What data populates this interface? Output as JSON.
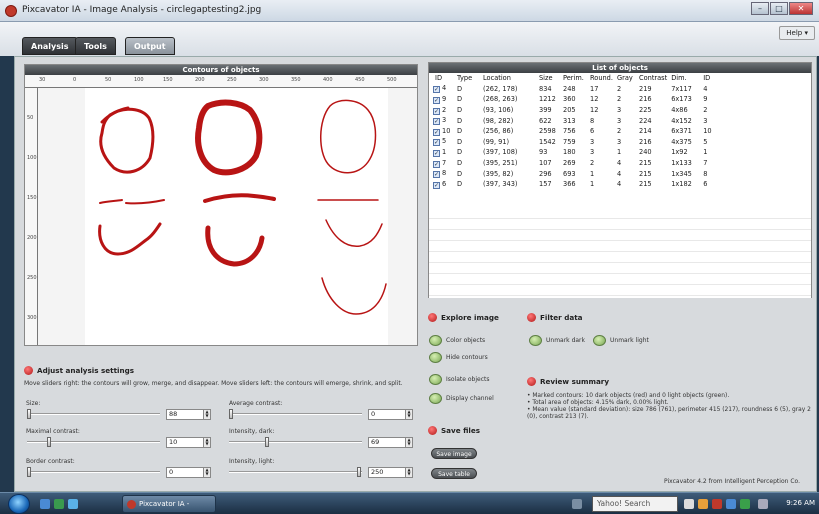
{
  "window": {
    "title": "Pixcavator IA - Image Analysis - circlegaptesting2.jpg",
    "minimize": "–",
    "maximize": "□",
    "close": "✕"
  },
  "tabs": [
    {
      "label": "Analysis"
    },
    {
      "label": "Tools"
    },
    {
      "label": "Output"
    }
  ],
  "help_label": "Help ▾",
  "contours_panel": {
    "title": "Contours of objects",
    "ruler_x": [
      "30",
      "0",
      "50",
      "100",
      "150",
      "200",
      "250",
      "300",
      "350",
      "400",
      "450",
      "500"
    ],
    "ruler_y": [
      "50",
      "100",
      "150",
      "200",
      "250",
      "300"
    ]
  },
  "objects_panel": {
    "title": "List of objects",
    "columns": [
      "ID",
      "Type",
      "Location",
      "Size",
      "Perim.",
      "Round.",
      "Gray",
      "Contrast",
      "Dim.",
      "ID"
    ],
    "rows": [
      [
        "4",
        "D",
        "(262, 178)",
        "834",
        "248",
        "17",
        "2",
        "219",
        "7x117",
        "4"
      ],
      [
        "9",
        "D",
        "(268, 263)",
        "1212",
        "360",
        "12",
        "2",
        "216",
        "6x173",
        "9"
      ],
      [
        "2",
        "D",
        "(93, 106)",
        "399",
        "205",
        "12",
        "3",
        "225",
        "4x86",
        "2"
      ],
      [
        "3",
        "D",
        "(98, 282)",
        "622",
        "313",
        "8",
        "3",
        "224",
        "4x152",
        "3"
      ],
      [
        "10",
        "D",
        "(256, 86)",
        "2598",
        "756",
        "6",
        "2",
        "214",
        "6x371",
        "10"
      ],
      [
        "5",
        "D",
        "(99, 91)",
        "1542",
        "759",
        "3",
        "3",
        "216",
        "4x375",
        "5"
      ],
      [
        "1",
        "D",
        "(397, 108)",
        "93",
        "180",
        "3",
        "1",
        "240",
        "1x92",
        "1"
      ],
      [
        "7",
        "D",
        "(395, 251)",
        "107",
        "269",
        "2",
        "4",
        "215",
        "1x133",
        "7"
      ],
      [
        "8",
        "D",
        "(395, 82)",
        "296",
        "693",
        "1",
        "4",
        "215",
        "1x345",
        "8"
      ],
      [
        "6",
        "D",
        "(397, 343)",
        "157",
        "366",
        "1",
        "4",
        "215",
        "1x182",
        "6"
      ]
    ]
  },
  "explore": {
    "title": "Explore image",
    "options": [
      "Color objects",
      "Hide contours",
      "Isolate objects",
      "Display channel"
    ]
  },
  "save": {
    "title": "Save files",
    "buttons": [
      "Save image",
      "Save table"
    ]
  },
  "filter": {
    "title": "Filter data",
    "options": [
      "Unmark dark",
      "Unmark light"
    ]
  },
  "review": {
    "title": "Review summary",
    "lines": [
      "• Marked contours: 10 dark objects (red) and 0 light objects (green).",
      "• Total area of objects: 4.15% dark, 0.00% light.",
      "• Mean value (standard deviation): size 786 (761), perimeter 415 (217), roundness 6 (5), gray 2 (0), contrast 213 (7)."
    ]
  },
  "settings": {
    "title": "Adjust analysis settings",
    "hint": "Move sliders right: the contours will grow, merge, and disappear. Move sliders left: the contours will emerge, shrink, and split.",
    "size": {
      "label": "Size:",
      "value": "88"
    },
    "avg_contrast": {
      "label": "Average contrast:",
      "value": "0"
    },
    "max_contrast": {
      "label": "Maximal contrast:",
      "value": "10"
    },
    "intensity_dark": {
      "label": "Intensity, dark:",
      "value": "69"
    },
    "border_contrast": {
      "label": "Border contrast:",
      "value": "0"
    },
    "intensity_light": {
      "label": "Intensity, light:",
      "value": "250"
    }
  },
  "footer": "Pixcavator 4.2 from Intelligent Perception Co.",
  "taskbar": {
    "task_label": "Pixcavator IA - Imag...",
    "search": "Yahoo! Search",
    "clock": "9:26 AM"
  },
  "colors": {
    "contour": "#b81414",
    "accent": "#c0392b"
  }
}
